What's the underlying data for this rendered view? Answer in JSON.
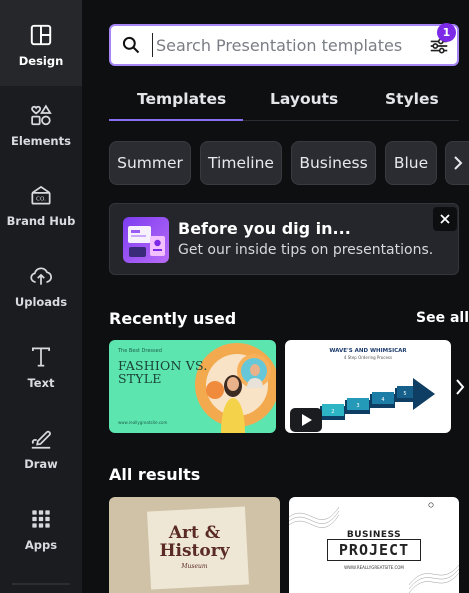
{
  "sidebar": {
    "items": [
      {
        "label": "Design",
        "icon": "design-layout-icon",
        "active": true
      },
      {
        "label": "Elements",
        "icon": "elements-shapes-icon"
      },
      {
        "label": "Brand Hub",
        "icon": "brand-hub-icon"
      },
      {
        "label": "Uploads",
        "icon": "cloud-upload-icon"
      },
      {
        "label": "Text",
        "icon": "text-t-icon"
      },
      {
        "label": "Draw",
        "icon": "draw-pen-icon"
      },
      {
        "label": "Apps",
        "icon": "apps-grid-icon"
      }
    ]
  },
  "search": {
    "placeholder": "Search Presentation templates",
    "filter_badge": "1"
  },
  "tabs": [
    {
      "label": "Templates",
      "active": true
    },
    {
      "label": "Layouts"
    },
    {
      "label": "Styles"
    }
  ],
  "chips": [
    "Summer",
    "Timeline",
    "Business",
    "Blue"
  ],
  "promo": {
    "title": "Before you dig in...",
    "subtitle": "Get our inside tips on presentations."
  },
  "recent": {
    "title": "Recently used",
    "see_all": "See all",
    "cards": [
      {
        "kicker": "The Best Dressed",
        "title_line1": "FASHION VS.",
        "title_line2": "STYLE",
        "footer": "www.reallygreatsite.com"
      },
      {
        "title": "WAVE'S AND WHIMSICAR",
        "subtitle": "4 Step Ordering Process",
        "steps": [
          "1",
          "2",
          "3",
          "4",
          "5"
        ]
      }
    ]
  },
  "all_results": {
    "title": "All results",
    "cards": [
      {
        "line1": "Art &",
        "line2": "History",
        "line3": "Museum"
      },
      {
        "line1": "BUSINESS",
        "line2": "PROJECT",
        "line3": "WWW.REALLYGREATSITE.COM"
      }
    ]
  },
  "colors": {
    "accent": "#8b6df1",
    "badge": "#7d2ae8",
    "panel_bg": "#0e0f11",
    "rail_bg": "#1b1c1f"
  }
}
